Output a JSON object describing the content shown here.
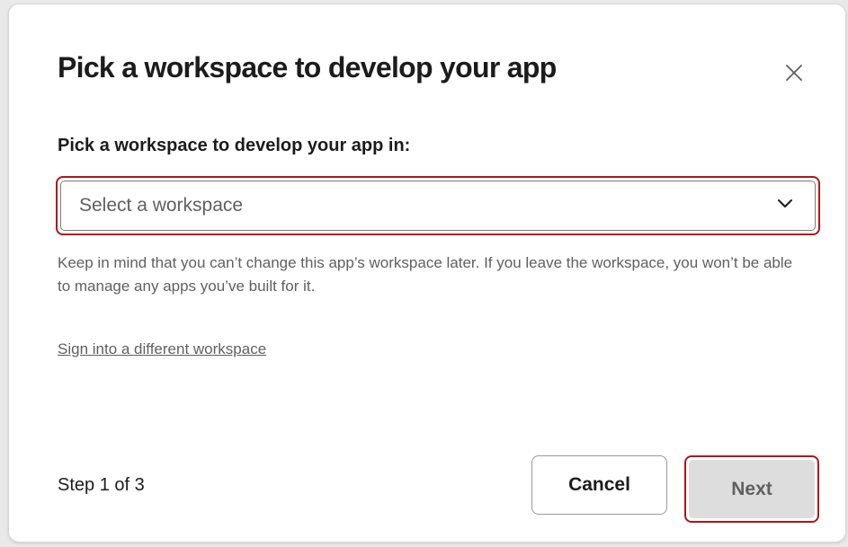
{
  "dialog": {
    "title": "Pick a workspace to develop your app",
    "close_icon": "close-x-icon"
  },
  "workspace_field": {
    "label": "Pick a workspace to develop your app in:",
    "placeholder": "Select a workspace",
    "selected_value": "",
    "dropdown_icon": "chevron-down-icon",
    "highlight_color": "#b01616"
  },
  "hint_text": "Keep in mind that you can’t change this app’s workspace later. If you leave the workspace, you won’t be able to manage any apps you’ve built for it.",
  "sign_in_link": "Sign into a different workspace",
  "footer": {
    "step": "Step 1 of 3",
    "cancel_label": "Cancel",
    "next_label": "Next"
  }
}
